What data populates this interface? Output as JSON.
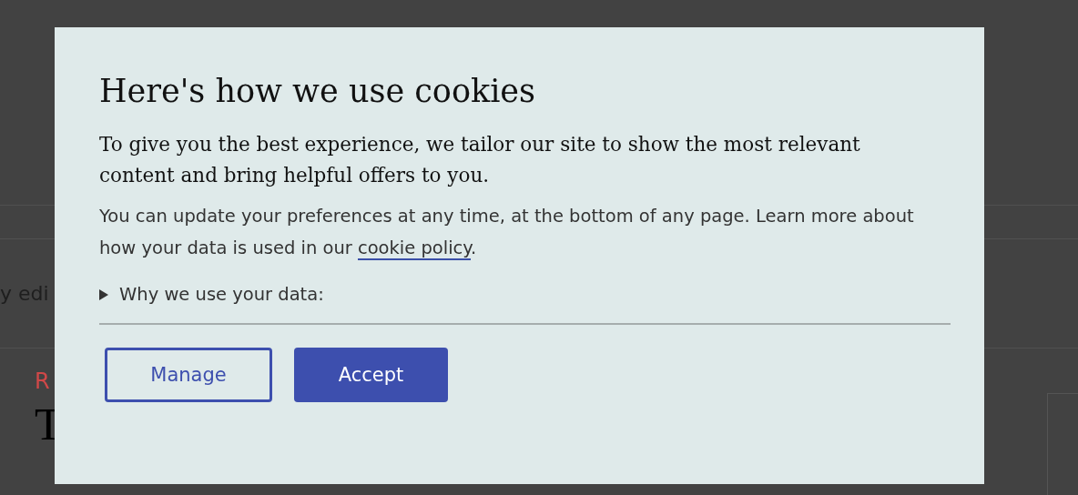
{
  "background_page": {
    "text_fragment": "y edi",
    "category_label": "R",
    "headline_fragment": "T"
  },
  "dialog": {
    "title": "Here's how we use cookies",
    "lead": "To give you the best experience, we tailor our site to show the most relevant content and bring helpful offers to you.",
    "body": "You can update your preferences at any time, at the bottom of any page. Learn more about how your data is used in our ",
    "link": "cookie policy",
    "body_end": ".",
    "disclosure": {
      "label": "Why we use your data:",
      "expanded": false
    },
    "buttons": [
      {
        "label": "Manage",
        "kind": "secondary"
      },
      {
        "label": "Accept",
        "kind": "primary"
      }
    ]
  }
}
